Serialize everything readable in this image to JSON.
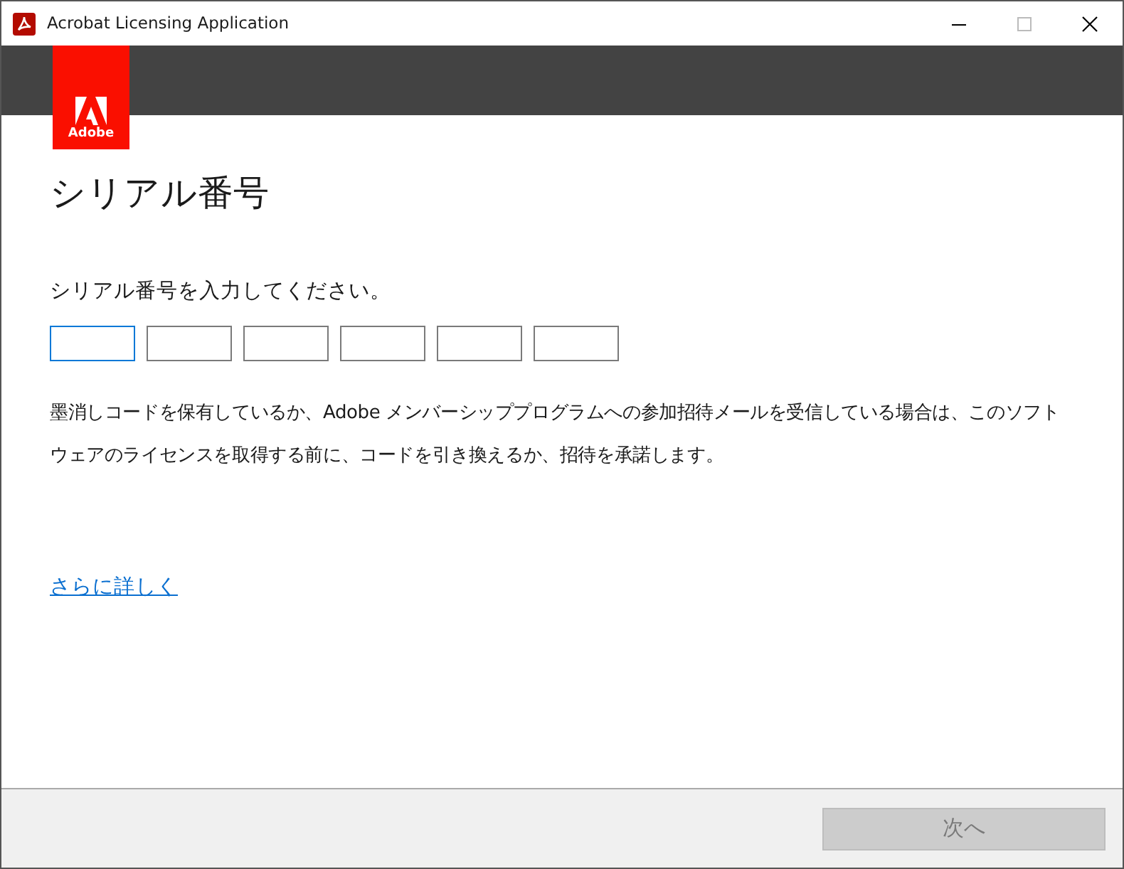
{
  "window": {
    "title": "Acrobat Licensing Application"
  },
  "logo": {
    "text": "Adobe"
  },
  "heading": "シリアル番号",
  "prompt": "シリアル番号を入力してください。",
  "serial_fields": [
    {
      "focused": true
    },
    {
      "focused": false
    },
    {
      "focused": false
    },
    {
      "focused": false
    },
    {
      "focused": false
    },
    {
      "focused": false
    }
  ],
  "description": "墨消しコードを保有しているか、Adobe メンバーシッププログラムへの参加招待メールを受信している場合は、このソフトウェアのライセンスを取得する前に、コードを引き換えるか、招待を承諾します。",
  "link": "さらに詳しく",
  "next_button": {
    "label": "次へ",
    "disabled": true
  }
}
